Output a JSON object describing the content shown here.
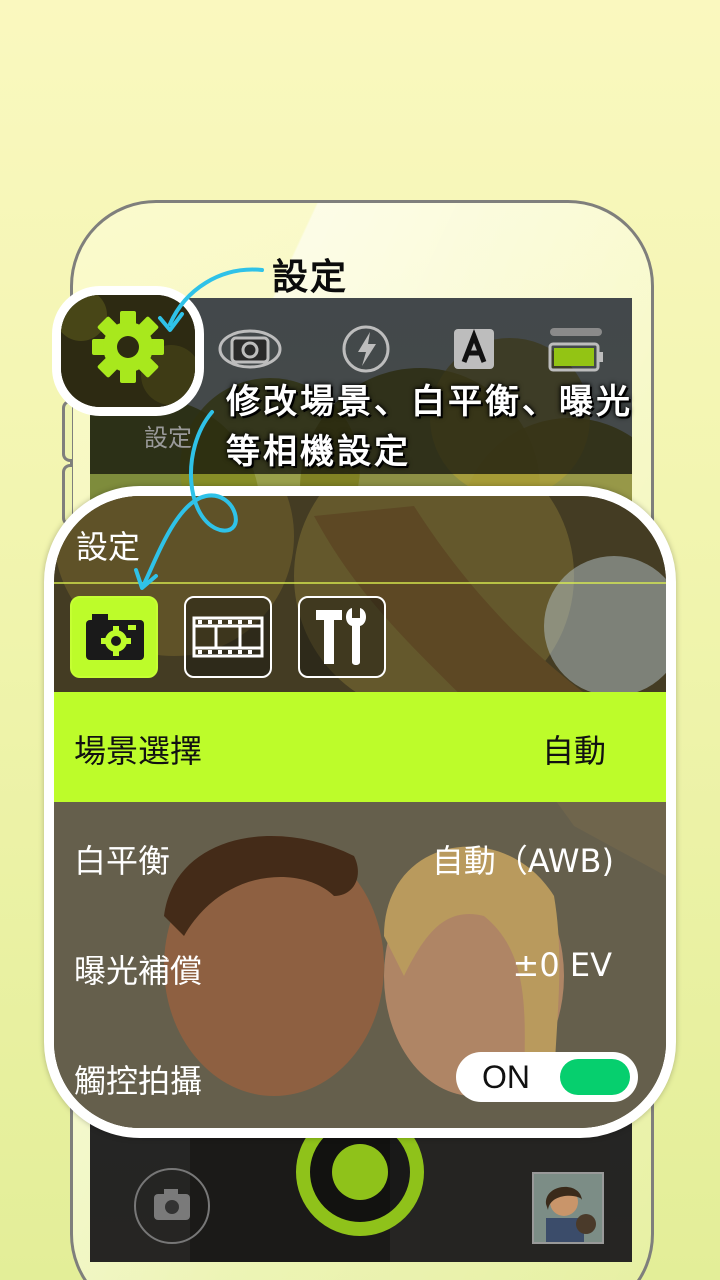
{
  "annotations": {
    "settings_title": "設定",
    "description_line1": "修改場景、白平衡、曝光",
    "description_line2": "等相機設定"
  },
  "topbar": {
    "settings_label": "設定",
    "icons": [
      "gear-icon",
      "camera-flip-icon",
      "flash-auto-icon",
      "auto-mode-icon",
      "battery-icon"
    ],
    "gear_color": "#a8e81d"
  },
  "panel": {
    "title": "設定",
    "tabs": [
      {
        "icon": "camera-settings-icon",
        "active": true
      },
      {
        "icon": "film-icon",
        "active": false
      },
      {
        "icon": "tools-icon",
        "active": false
      }
    ],
    "rows": {
      "scene": {
        "label": "場景選擇",
        "value": "自動"
      },
      "white_balance": {
        "label": "白平衡",
        "value": "自動（AWB)"
      },
      "exposure": {
        "label": "曝光補償",
        "value": "±0 EV"
      },
      "touch_shot": {
        "label": "觸控拍攝",
        "toggle": "ON",
        "enabled": true
      }
    },
    "accent_color": "#bdfc2a",
    "toggle_color": "#06cf6e"
  },
  "bottombar": {
    "icons": [
      "camera-switch-icon",
      "shutter-button",
      "gallery-thumbnail"
    ],
    "shutter_color": "#8fc21a"
  },
  "callout_arrow_color": "#2fc2e8"
}
